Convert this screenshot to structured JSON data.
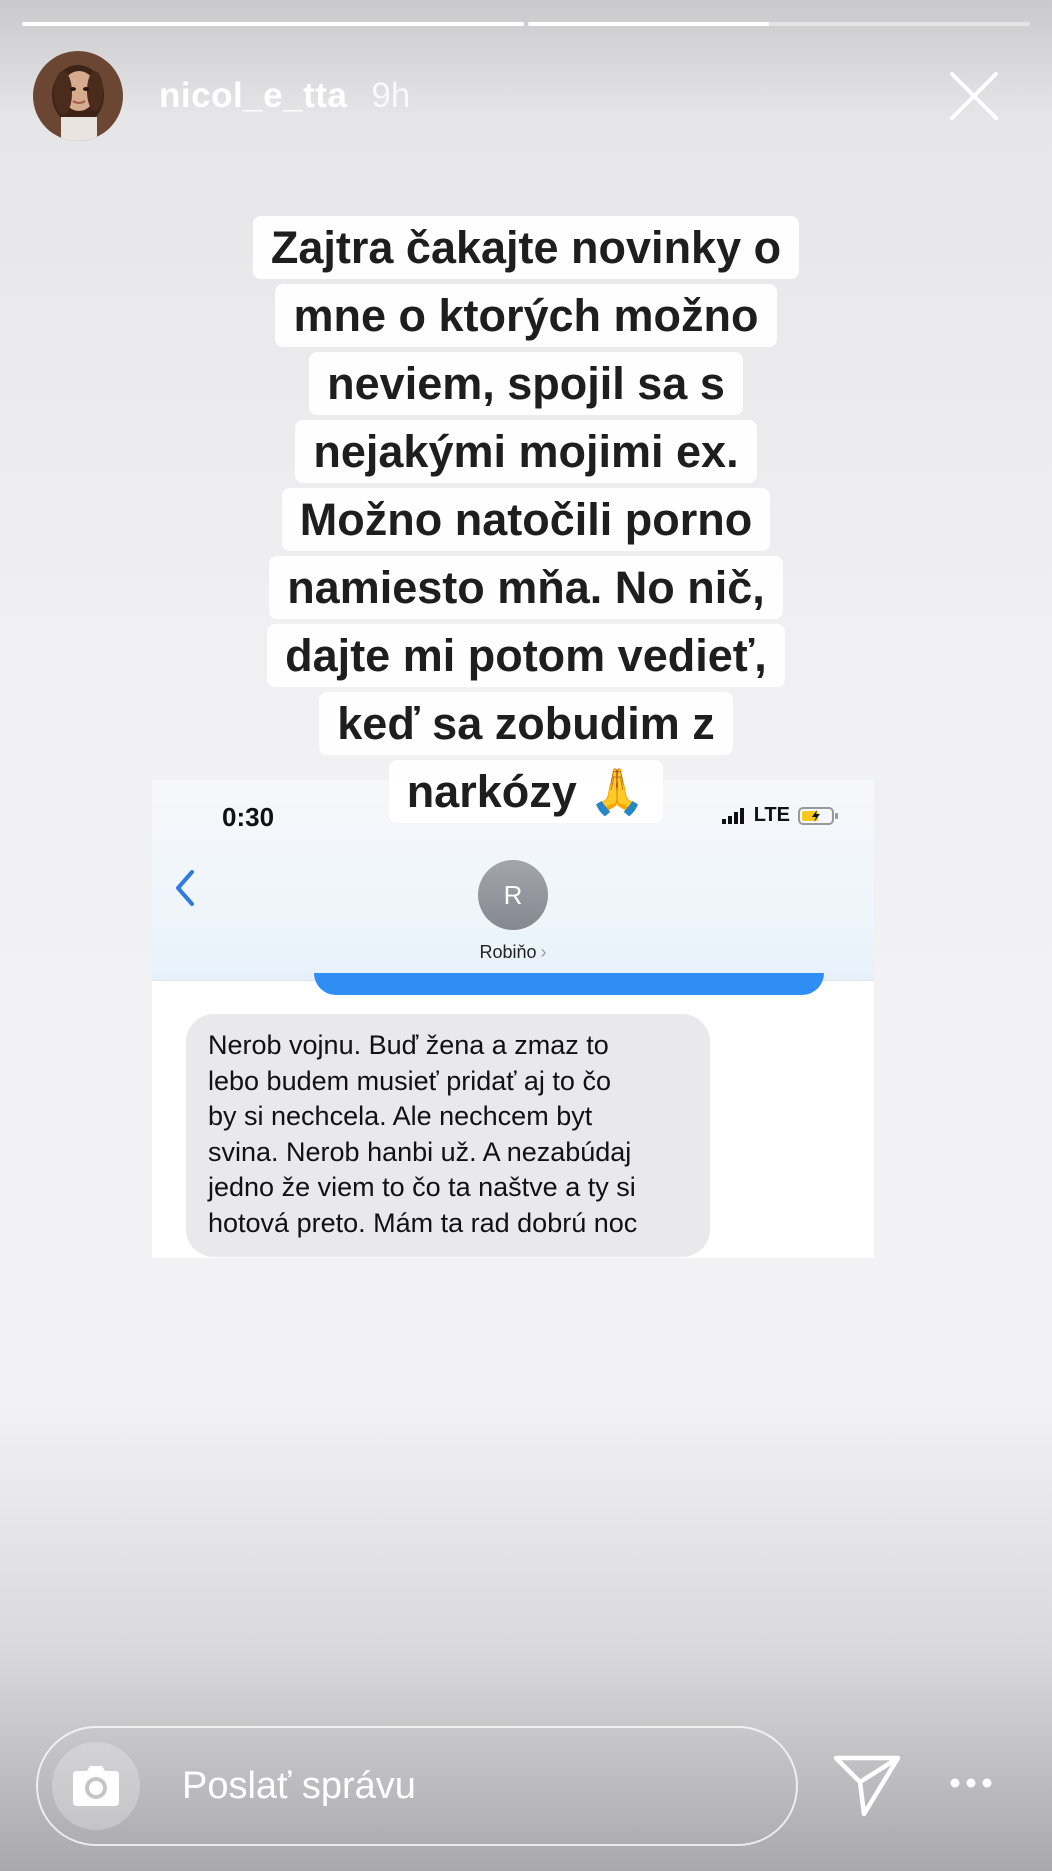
{
  "progress": {
    "segments_total": 2,
    "segments_completed": 1,
    "current_segment_fraction": 0.48
  },
  "header": {
    "username": "nicol_e_tta",
    "time_ago": "9h",
    "close_icon": "close-icon"
  },
  "caption": {
    "lines": [
      "Zajtra čakajte novinky o",
      "mne o ktorých možno",
      "neviem, spojil sa s",
      "nejakými mojimi ex.",
      "Možno natočili porno",
      "namiesto mňa. No nič,",
      "dajte mi potom vedieť,",
      "keď sa zobudim z",
      "narkózy 🙏"
    ]
  },
  "screenshot": {
    "clock": "0:30",
    "network": "LTE",
    "contact_initial": "R",
    "contact_name": "Robiňo",
    "received_message_lines": [
      "Nerob vojnu. Buď žena a zmaz to",
      "lebo budem musieť pridať aj to čo",
      "by si nechcela. Ale nechcem byt",
      "svina. Nerob hanbi už. A nezabúdaj",
      "jedno že viem to čo ta naštve a ty si",
      "hotová preto. Mám ta rad dobrú noc"
    ]
  },
  "footer": {
    "reply_placeholder": "Poslať správu",
    "icons": [
      "camera-icon",
      "send-icon",
      "more-icon"
    ]
  },
  "colors": {
    "sent_bubble": "#2f8ef4",
    "received_bubble": "#e9e9eb",
    "ios_blue": "#2f7ce0"
  }
}
